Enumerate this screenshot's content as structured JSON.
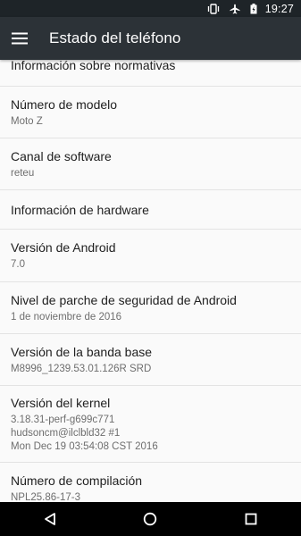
{
  "status_bar": {
    "time": "19:27",
    "icons": [
      "vibrate-icon",
      "airplane-mode-icon",
      "battery-icon"
    ]
  },
  "toolbar": {
    "title": "Estado del teléfono",
    "menu_icon": "hamburger-menu-icon"
  },
  "items": [
    {
      "title": "Información sobre normativas",
      "subtitle": []
    },
    {
      "title": "Número de modelo",
      "subtitle": [
        "Moto Z"
      ]
    },
    {
      "title": "Canal de software",
      "subtitle": [
        "reteu"
      ]
    },
    {
      "title": "Información de hardware",
      "subtitle": []
    },
    {
      "title": "Versión de Android",
      "subtitle": [
        "7.0"
      ]
    },
    {
      "title": "Nivel de parche de seguridad de Android",
      "subtitle": [
        "1 de noviembre de 2016"
      ]
    },
    {
      "title": "Versión de la banda base",
      "subtitle": [
        "M8996_1239.53.01.126R SRD"
      ]
    },
    {
      "title": "Versión del kernel",
      "subtitle": [
        "3.18.31-perf-g699c771",
        "hudsoncm@ilclbld32 #1",
        "Mon Dec 19 03:54:08 CST 2016"
      ]
    },
    {
      "title": "Número de compilación",
      "subtitle": [
        "NPL25.86-17-3"
      ]
    }
  ],
  "nav_bar": {
    "icons": [
      "back-icon",
      "home-icon",
      "recents-icon"
    ]
  }
}
